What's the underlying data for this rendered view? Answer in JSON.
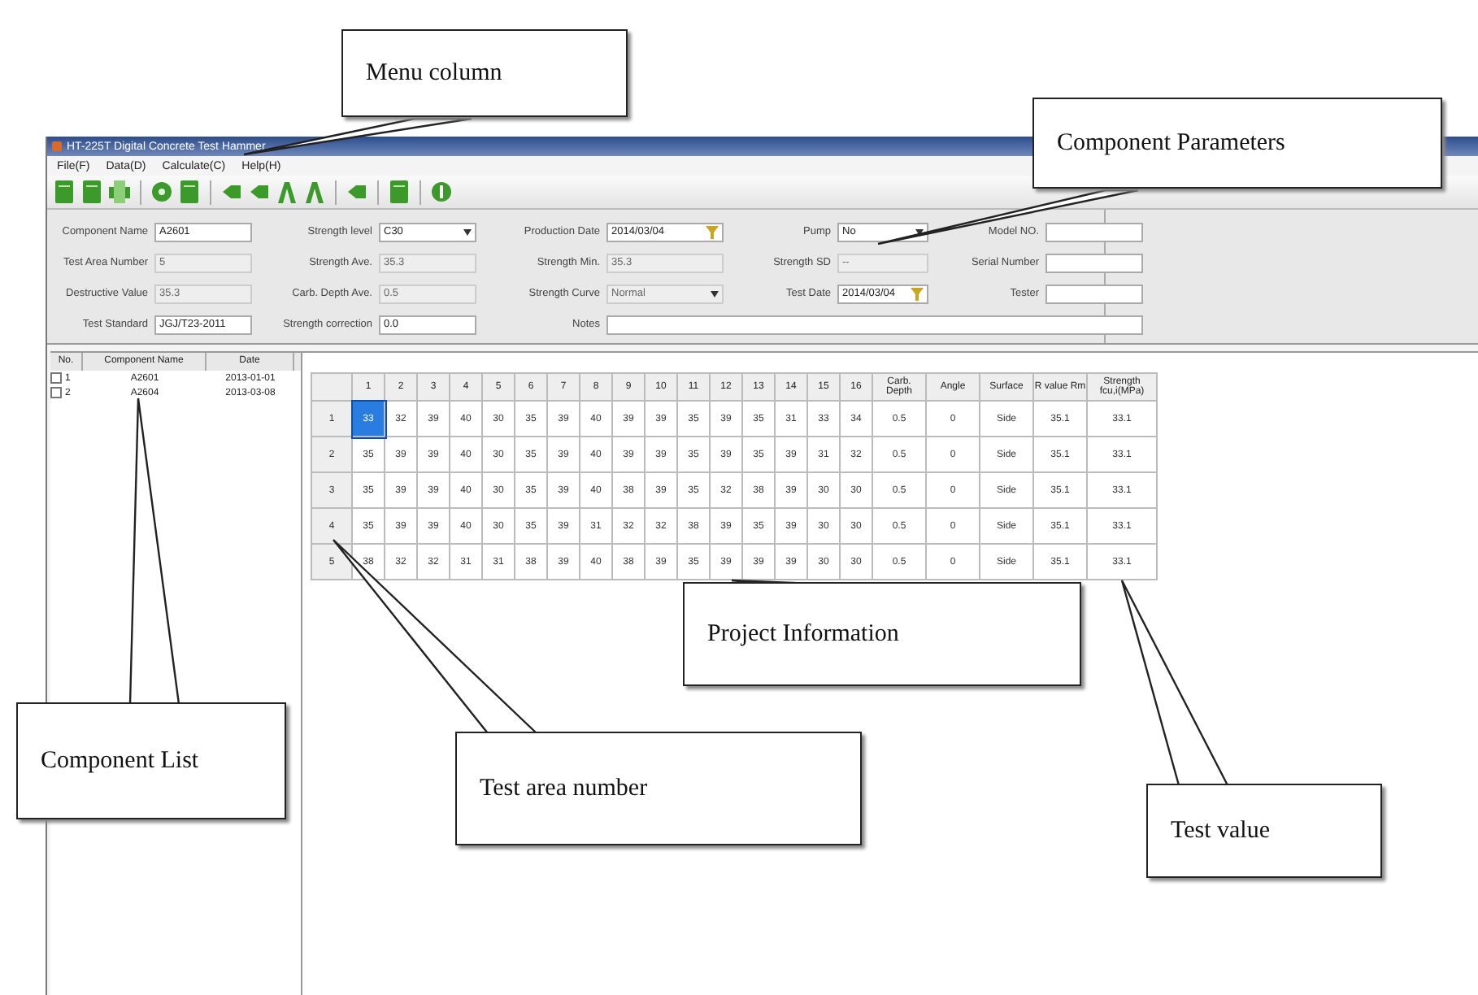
{
  "window": {
    "title": "HT-225T Digital Concrete Test Hammer"
  },
  "menu": [
    {
      "label": "File(F)"
    },
    {
      "label": "Data(D)"
    },
    {
      "label": "Calculate(C)"
    },
    {
      "label": "Help(H)"
    }
  ],
  "parameters": [
    {
      "label": "Component Name",
      "kind": "text",
      "value": "A2601",
      "disabled": false
    },
    {
      "label": "Strength level",
      "kind": "select",
      "value": "C30",
      "disabled": false
    },
    {
      "label": "Production Date",
      "kind": "date",
      "value": "2014/03/04",
      "disabled": false
    },
    {
      "label": "Pump",
      "kind": "select",
      "value": "No",
      "disabled": false
    },
    {
      "label": "Model NO.",
      "kind": "text",
      "disabled": false
    },
    {
      "label": "Test Area Number",
      "kind": "text",
      "value": "5",
      "disabled": true
    },
    {
      "label": "Strength Ave.",
      "kind": "text",
      "value": "35.3",
      "disabled": true
    },
    {
      "label": "Strength Min.",
      "kind": "text",
      "value": "35.3",
      "disabled": true
    },
    {
      "label": "Strength SD",
      "kind": "text",
      "value": "--",
      "disabled": true
    },
    {
      "label": "Serial Number",
      "kind": "text",
      "disabled": false
    },
    {
      "label": "Destructive Value",
      "kind": "text",
      "value": "35.3",
      "disabled": true
    },
    {
      "label": "Carb. Depth Ave.",
      "kind": "text",
      "value": "0.5",
      "disabled": true
    },
    {
      "label": "Strength Curve",
      "kind": "select",
      "value": "Normal",
      "disabled": true
    },
    {
      "label": "Test Date",
      "kind": "date",
      "value": "2014/03/04",
      "disabled": false
    },
    {
      "label": "Tester",
      "kind": "text",
      "disabled": false
    },
    {
      "label": "Test Standard",
      "kind": "text",
      "value": "JGJ/T23-2011",
      "disabled": false
    },
    {
      "label": "Strength correction",
      "kind": "text",
      "value": "0.0",
      "disabled": false
    },
    {
      "label": "Notes",
      "kind": "wide",
      "disabled": false
    }
  ],
  "component_list": {
    "columns": [
      "No.",
      "Component Name",
      "Date"
    ],
    "rows": [
      {
        "checked": false,
        "no": "1",
        "name": "A2601",
        "date": "2013-01-01"
      },
      {
        "checked": false,
        "no": "2",
        "name": "A2604",
        "date": "2013-03-08"
      }
    ]
  },
  "table": {
    "columns": [
      "1",
      "2",
      "3",
      "4",
      "5",
      "6",
      "7",
      "8",
      "9",
      "10",
      "11",
      "12",
      "13",
      "14",
      "15",
      "16",
      "Carb. Depth",
      "Angle",
      "Surface",
      "R value Rm",
      "Strength fcu,i(MPa)"
    ],
    "rows": [
      {
        "label": "1",
        "cells": [
          {
            "text": "33",
            "selected": true
          },
          {
            "text": "32",
            "selected": false
          },
          {
            "text": "39",
            "selected": false
          },
          {
            "text": "40",
            "selected": false
          },
          {
            "text": "30",
            "selected": false
          },
          {
            "text": "35",
            "selected": false
          },
          {
            "text": "39",
            "selected": false
          },
          {
            "text": "40",
            "selected": false
          },
          {
            "text": "39",
            "selected": false
          },
          {
            "text": "39",
            "selected": false
          },
          {
            "text": "35",
            "selected": false
          },
          {
            "text": "39",
            "selected": false
          },
          {
            "text": "35",
            "selected": false
          },
          {
            "text": "31",
            "selected": false
          },
          {
            "text": "33",
            "selected": false
          },
          {
            "text": "34",
            "selected": false
          },
          {
            "text": "0.5",
            "selected": false
          },
          {
            "text": "0",
            "selected": false
          },
          {
            "text": "Side",
            "selected": false
          },
          {
            "text": "35.1",
            "selected": false
          },
          {
            "text": "33.1",
            "selected": false
          }
        ]
      },
      {
        "label": "2",
        "cells": [
          {
            "text": "35",
            "selected": false
          },
          {
            "text": "39",
            "selected": false
          },
          {
            "text": "39",
            "selected": false
          },
          {
            "text": "40",
            "selected": false
          },
          {
            "text": "30",
            "selected": false
          },
          {
            "text": "35",
            "selected": false
          },
          {
            "text": "39",
            "selected": false
          },
          {
            "text": "40",
            "selected": false
          },
          {
            "text": "39",
            "selected": false
          },
          {
            "text": "39",
            "selected": false
          },
          {
            "text": "35",
            "selected": false
          },
          {
            "text": "39",
            "selected": false
          },
          {
            "text": "35",
            "selected": false
          },
          {
            "text": "39",
            "selected": false
          },
          {
            "text": "31",
            "selected": false
          },
          {
            "text": "32",
            "selected": false
          },
          {
            "text": "0.5",
            "selected": false
          },
          {
            "text": "0",
            "selected": false
          },
          {
            "text": "Side",
            "selected": false
          },
          {
            "text": "35.1",
            "selected": false
          },
          {
            "text": "33.1",
            "selected": false
          }
        ]
      },
      {
        "label": "3",
        "cells": [
          {
            "text": "35",
            "selected": false
          },
          {
            "text": "39",
            "selected": false
          },
          {
            "text": "39",
            "selected": false
          },
          {
            "text": "40",
            "selected": false
          },
          {
            "text": "30",
            "selected": false
          },
          {
            "text": "35",
            "selected": false
          },
          {
            "text": "39",
            "selected": false
          },
          {
            "text": "40",
            "selected": false
          },
          {
            "text": "38",
            "selected": false
          },
          {
            "text": "39",
            "selected": false
          },
          {
            "text": "35",
            "selected": false
          },
          {
            "text": "32",
            "selected": false
          },
          {
            "text": "38",
            "selected": false
          },
          {
            "text": "39",
            "selected": false
          },
          {
            "text": "30",
            "selected": false
          },
          {
            "text": "30",
            "selected": false
          },
          {
            "text": "0.5",
            "selected": false
          },
          {
            "text": "0",
            "selected": false
          },
          {
            "text": "Side",
            "selected": false
          },
          {
            "text": "35.1",
            "selected": false
          },
          {
            "text": "33.1",
            "selected": false
          }
        ]
      },
      {
        "label": "4",
        "cells": [
          {
            "text": "35",
            "selected": false
          },
          {
            "text": "39",
            "selected": false
          },
          {
            "text": "39",
            "selected": false
          },
          {
            "text": "40",
            "selected": false
          },
          {
            "text": "30",
            "selected": false
          },
          {
            "text": "35",
            "selected": false
          },
          {
            "text": "39",
            "selected": false
          },
          {
            "text": "31",
            "selected": false
          },
          {
            "text": "32",
            "selected": false
          },
          {
            "text": "32",
            "selected": false
          },
          {
            "text": "38",
            "selected": false
          },
          {
            "text": "39",
            "selected": false
          },
          {
            "text": "35",
            "selected": false
          },
          {
            "text": "39",
            "selected": false
          },
          {
            "text": "30",
            "selected": false
          },
          {
            "text": "30",
            "selected": false
          },
          {
            "text": "0.5",
            "selected": false
          },
          {
            "text": "0",
            "selected": false
          },
          {
            "text": "Side",
            "selected": false
          },
          {
            "text": "35.1",
            "selected": false
          },
          {
            "text": "33.1",
            "selected": false
          }
        ]
      },
      {
        "label": "5",
        "cells": [
          {
            "text": "38",
            "selected": false
          },
          {
            "text": "32",
            "selected": false
          },
          {
            "text": "32",
            "selected": false
          },
          {
            "text": "31",
            "selected": false
          },
          {
            "text": "31",
            "selected": false
          },
          {
            "text": "38",
            "selected": false
          },
          {
            "text": "39",
            "selected": false
          },
          {
            "text": "40",
            "selected": false
          },
          {
            "text": "38",
            "selected": false
          },
          {
            "text": "39",
            "selected": false
          },
          {
            "text": "35",
            "selected": false
          },
          {
            "text": "39",
            "selected": false
          },
          {
            "text": "39",
            "selected": false
          },
          {
            "text": "39",
            "selected": false
          },
          {
            "text": "30",
            "selected": false
          },
          {
            "text": "30",
            "selected": false
          },
          {
            "text": "0.5",
            "selected": false
          },
          {
            "text": "0",
            "selected": false
          },
          {
            "text": "Side",
            "selected": false
          },
          {
            "text": "35.1",
            "selected": false
          },
          {
            "text": "33.1",
            "selected": false
          }
        ]
      }
    ]
  },
  "callouts": [
    {
      "text": "Menu column"
    },
    {
      "text": "Component Parameters"
    },
    {
      "text": "Project Information"
    },
    {
      "text": "Component List"
    },
    {
      "text": "Test area number"
    },
    {
      "text": "Test value"
    }
  ]
}
